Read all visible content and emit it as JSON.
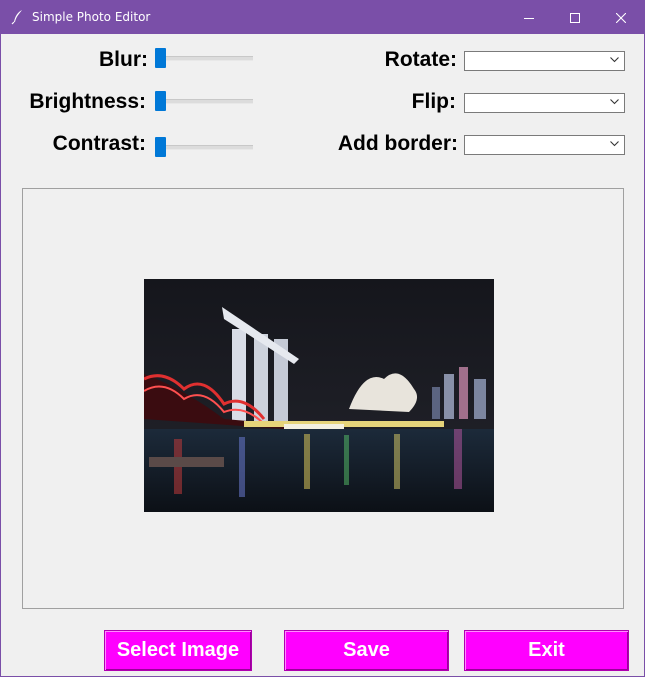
{
  "window": {
    "title": "Simple Photo Editor"
  },
  "controls": {
    "blur_label": "Blur:",
    "brightness_label": "Brightness:",
    "contrast_label": "Contrast:",
    "rotate_label": "Rotate:",
    "flip_label": "Flip:",
    "border_label": "Add border:",
    "blur_value": 0,
    "brightness_value": 0,
    "contrast_value": 0,
    "rotate_value": "",
    "flip_value": "",
    "border_value": ""
  },
  "buttons": {
    "select_image": "Select Image",
    "save": "Save",
    "exit": "Exit"
  },
  "colors": {
    "titlebar": "#7a4fa8",
    "button_bg": "#ff00ff",
    "slider_thumb": "#0078d7"
  }
}
